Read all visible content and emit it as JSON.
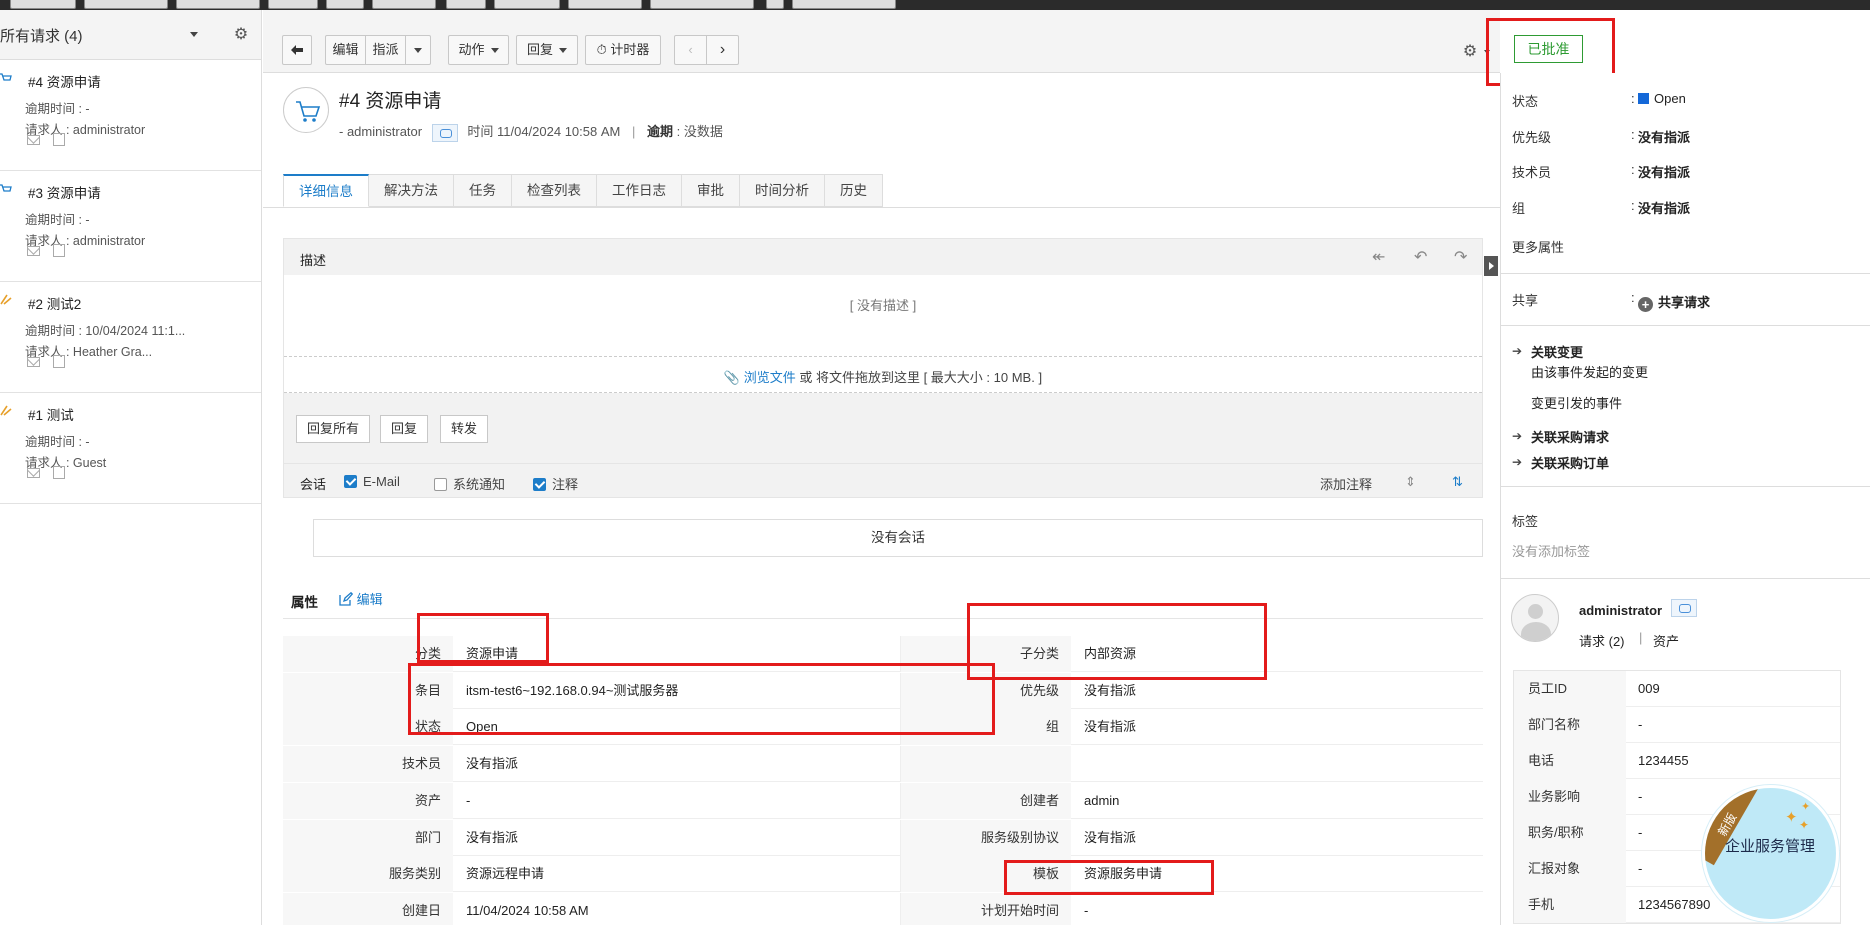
{
  "left": {
    "title": "所有请求 (4)",
    "requests": [
      {
        "title": "#4 资源申请",
        "due": "逾期时间 : -",
        "requester": "请求人 : administrator"
      },
      {
        "title": "#3 资源申请",
        "due": "逾期时间 : -",
        "requester": "请求人 : administrator"
      },
      {
        "title": "#2 测试2",
        "due": "逾期时间 : 10/04/2024 11:1...",
        "requester": "请求人 : Heather Gra..."
      },
      {
        "title": "#1 测试",
        "due": "逾期时间 : -",
        "requester": "请求人 : Guest"
      }
    ]
  },
  "toolbar": {
    "edit": "编辑",
    "assign": "指派",
    "action": "动作",
    "reply": "回复",
    "timer": "计时器",
    "status_badge": "已批准"
  },
  "request": {
    "title": "#4 资源申请",
    "author": "administrator",
    "time_label": "时间",
    "time": "11/04/2024 10:58 AM",
    "due_label": "逾期",
    "due": "没数据"
  },
  "tabs": [
    "详细信息",
    "解决方法",
    "任务",
    "检查列表",
    "工作日志",
    "审批",
    "时间分析",
    "历史"
  ],
  "description": {
    "label": "描述",
    "empty": "[ 没有描述 ]",
    "browse": "浏览文件",
    "upload_tail": " 或 将文件拖放到这里 [ 最大大小 : 10 MB. ]",
    "reply_all": "回复所有",
    "reply": "回复",
    "forward": "转发"
  },
  "conversation": {
    "label": "会话",
    "email": "E-Mail",
    "system": "系统通知",
    "note": "注释",
    "add_note": "添加注释",
    "empty": "没有会话"
  },
  "properties": {
    "title": "属性",
    "edit": "编辑",
    "rows": [
      {
        "l1": "分类",
        "v1": "资源申请",
        "l2": "子分类",
        "v2": "内部资源"
      },
      {
        "l1": "条目",
        "v1": "itsm-test6~192.168.0.94~测试服务器",
        "l2": "优先级",
        "v2": "没有指派"
      },
      {
        "l1": "状态",
        "v1": "Open",
        "l2": "组",
        "v2": "没有指派"
      },
      {
        "l1": "技术员",
        "v1": "没有指派",
        "l2": "",
        "v2": ""
      },
      {
        "l1": "资产",
        "v1": "-",
        "l2": "创建者",
        "v2": "admin"
      },
      {
        "l1": "部门",
        "v1": "没有指派",
        "l2": "服务级别协议",
        "v2": "没有指派"
      },
      {
        "l1": "服务类别",
        "v1": "资源远程申请",
        "l2": "模板",
        "v2": "资源服务申请"
      },
      {
        "l1": "创建日",
        "v1": "11/04/2024 10:58 AM",
        "l2": "计划开始时间",
        "v2": "-"
      }
    ]
  },
  "right": {
    "status_label": "状态",
    "status_value": "Open",
    "priority_label": "优先级",
    "priority_value": "没有指派",
    "tech_label": "技术员",
    "tech_value": "没有指派",
    "group_label": "组",
    "group_value": "没有指派",
    "more": "更多属性",
    "share_label": "共享",
    "share_value": "共享请求",
    "linked_change": "关联变更",
    "change_from_incident": "由该事件发起的变更",
    "incident_from_change": "变更引发的事件",
    "linked_pr": "关联采购请求",
    "linked_po": "关联采购订单",
    "tags_label": "标签",
    "no_tags": "没有添加标签",
    "user_name": "administrator",
    "user_requests": "请求 (2)",
    "user_assets": "资产",
    "user_fields": [
      {
        "k": "员工ID",
        "v": "009"
      },
      {
        "k": "部门名称",
        "v": "-"
      },
      {
        "k": "电话",
        "v": "1234455"
      },
      {
        "k": "业务影响",
        "v": "-"
      },
      {
        "k": "职务/职称",
        "v": "-"
      },
      {
        "k": "汇报对象",
        "v": "-"
      },
      {
        "k": "手机",
        "v": "1234567890"
      }
    ]
  },
  "ad": {
    "ribbon": "新版",
    "text": "企业服务管理"
  },
  "colors": {
    "accent": "#1d7dc9",
    "approved": "#2e9b33",
    "highlight": "#e31b1b",
    "status_open": "#1468d8"
  }
}
